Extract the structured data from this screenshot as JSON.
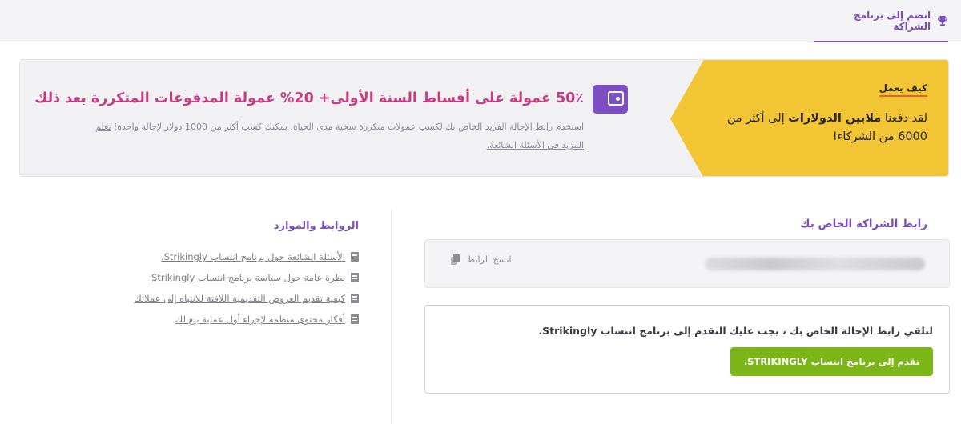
{
  "tabs": [
    {
      "label": "انضم إلى برنامج الشراكة",
      "icon": "trophy-icon",
      "active": true
    }
  ],
  "banner": {
    "how_label": "كيف يعمل",
    "how_text_pre": "لقد دفعنا ",
    "how_text_bold": "ملايين الدولارات",
    "how_text_post": " إلى أكثر من 6000 من الشركاء!",
    "icon": "wallet-icon",
    "commission": "50٪ عمولة على أقساط السنة الأولى+ 20% عمولة المدفوعات المتكررة بعد ذلك",
    "description": "استخدم رابط الإحالة الفريد الخاص بك لكسب عمولات متكررة سخية مدى الحياة. يمكنك كسب أكثر من 1000 دولار لإحالة واحدة! ",
    "learn_more": "تعلم المزيد في الأسئلة الشائعة."
  },
  "resources": {
    "title": "الروابط والموارد",
    "items": [
      "الأسئلة الشائعة حول برنامج انتساب Strikingly.",
      "نظرة عامة حول سياسة برنامج انتساب Strikingly",
      "كيفية تقديم العروض التقديمية اللافتة للانتباه إلى عملائك",
      "أفكار محتوى منظمة لإجراء أول عملية بيع لك"
    ]
  },
  "affiliate_link": {
    "title": "رابط الشراكة الخاص بك",
    "copy_label": "انسخ الرابط"
  },
  "apply": {
    "text": "لتلقي رابط الإحالة الخاص بك ، يجب عليك التقدم إلى برنامج انتساب Strikingly.",
    "button": "تقدم إلى برنامج انتساب STRIKINGLY."
  },
  "colors": {
    "accent": "#7c4dbd",
    "highlight": "#c63f84",
    "banner_yellow": "#f2c535",
    "button_green": "#7cb518"
  }
}
